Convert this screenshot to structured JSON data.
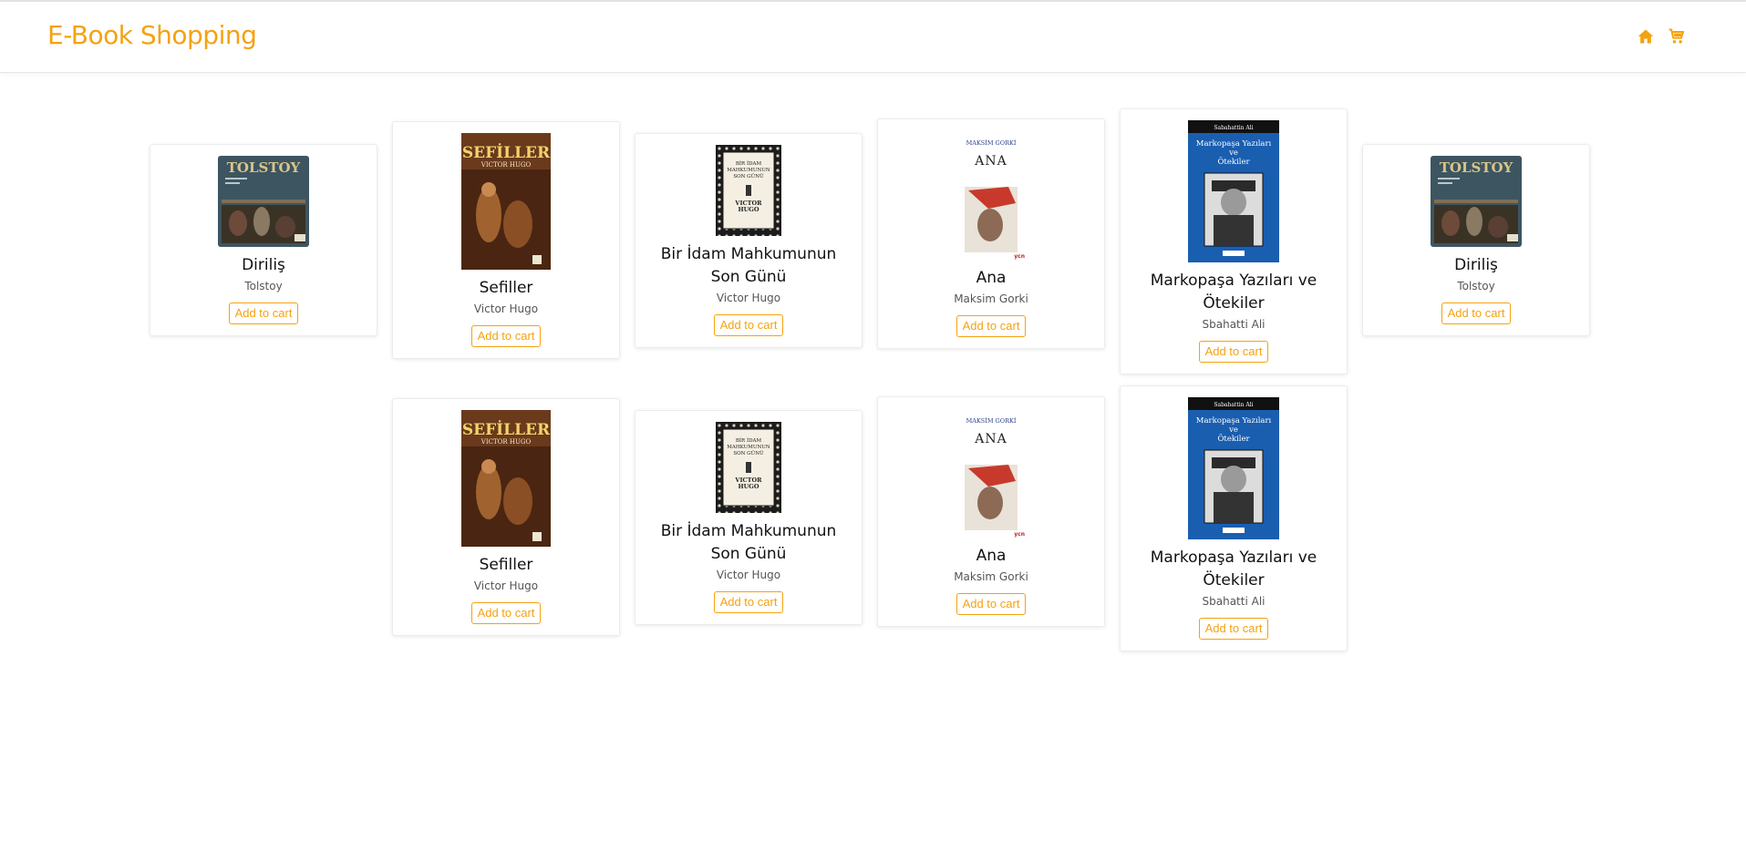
{
  "app": {
    "brand": "E-Book Shopping",
    "accent": "#f5a20f"
  },
  "nav": {
    "icons": [
      "home-icon",
      "cart-icon"
    ]
  },
  "books": [
    {
      "title": "Diriliş",
      "author": "Tolstoy",
      "button": "Add to cart",
      "cover": "tolstoy"
    },
    {
      "title": "Sefiller",
      "author": "Victor Hugo",
      "button": "Add to cart",
      "cover": "sefiller"
    },
    {
      "title": "Bir İdam Mahkumunun Son Günü",
      "author": "Victor Hugo",
      "button": "Add to cart",
      "cover": "idam"
    },
    {
      "title": "Ana",
      "author": "Maksim Gorki",
      "button": "Add to cart",
      "cover": "ana"
    },
    {
      "title": "Markopaşa Yazıları ve Ötekiler",
      "author": "Sbahatti Ali",
      "button": "Add to cart",
      "cover": "markopasa"
    },
    {
      "title": "Diriliş",
      "author": "Tolstoy",
      "button": "Add to cart",
      "cover": "tolstoy"
    },
    {
      "title": "Sefiller",
      "author": "Victor Hugo",
      "button": "Add to cart",
      "cover": "sefiller"
    },
    {
      "title": "Bir İdam Mahkumunun Son Günü",
      "author": "Victor Hugo",
      "button": "Add to cart",
      "cover": "idam"
    },
    {
      "title": "Ana",
      "author": "Maksim Gorki",
      "button": "Add to cart",
      "cover": "ana"
    },
    {
      "title": "Markopaşa Yazıları ve Ötekiler",
      "author": "Sbahatti Ali",
      "button": "Add to cart",
      "cover": "markopasa"
    }
  ],
  "cover_text": {
    "tolstoy": "TOLSTOY",
    "sefiller": [
      "SEFİLLER",
      "VICTOR HUGO"
    ],
    "idam": [
      "BİR İDAM",
      "MAHKUMUNUN",
      "SON GÜNÜ",
      "VICTOR",
      "HUGO"
    ],
    "ana": [
      "MAKSİM GORKİ",
      "ANA"
    ],
    "markopasa": [
      "Sabahattin Ali",
      "Markopaşa Yazıları",
      "ve",
      "Ötekiler"
    ]
  }
}
